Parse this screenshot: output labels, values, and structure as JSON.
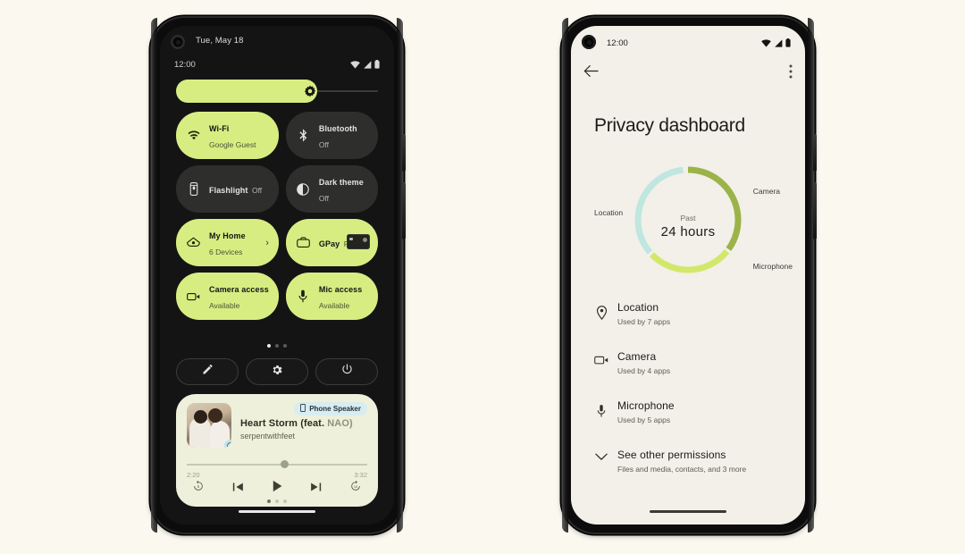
{
  "background_color": "#fbf8f0",
  "accent_green": "#d7ed82",
  "left_phone": {
    "name": "quick-settings-panel",
    "status_bar": {
      "date": "Tue, May 18",
      "clock": "12:00",
      "icons": [
        "wifi-icon",
        "signal-icon",
        "battery-icon"
      ]
    },
    "brightness": {
      "label": "brightness-slider",
      "icon": "brightness-icon",
      "value_percent": 70
    },
    "tiles": [
      {
        "label": "Wi-Fi",
        "sub": "Google Guest",
        "icon": "wifi-icon",
        "state": "on"
      },
      {
        "label": "Bluetooth",
        "sub": "Off",
        "icon": "bluetooth-icon",
        "state": "off"
      },
      {
        "label": "Flashlight",
        "sub": "Off",
        "icon": "flashlight-icon",
        "state": "off"
      },
      {
        "label": "Dark theme",
        "sub": "Off",
        "icon": "contrast-icon",
        "state": "off"
      },
      {
        "label": "My Home",
        "sub": "6 Devices",
        "icon": "home-icon",
        "state": "on",
        "chevron": "›"
      },
      {
        "label": "GPay",
        "sub": "Ready",
        "icon": "wallet-icon",
        "state": "on",
        "card": true
      },
      {
        "label": "Camera access",
        "sub": "Available",
        "icon": "camera-icon",
        "state": "on"
      },
      {
        "label": "Mic access",
        "sub": "Available",
        "icon": "mic-icon",
        "state": "on"
      }
    ],
    "page_dots": {
      "count": 3,
      "active_index": 0
    },
    "actions": [
      {
        "name": "edit-tiles-button",
        "icon": "pencil-icon"
      },
      {
        "name": "settings-button",
        "icon": "gear-icon"
      },
      {
        "name": "power-button",
        "icon": "power-icon"
      }
    ],
    "media": {
      "output_chip": {
        "label": "Phone Speaker",
        "icon": "phone-icon"
      },
      "title": "Heart Storm (feat. ",
      "title_feat": "NAO)",
      "artist": "serpentwithfeet",
      "elapsed": "2:20",
      "duration": "3:32",
      "progress_percent": 52,
      "controls": [
        "replay-5-icon",
        "previous-track-icon",
        "play-icon",
        "next-track-icon",
        "forward-15-icon"
      ],
      "art_badge": "play-badge-icon",
      "page_dots": {
        "count": 3,
        "active_index": 0
      }
    }
  },
  "right_phone": {
    "name": "privacy-dashboard-screen",
    "status_bar": {
      "clock": "12:00",
      "icons": [
        "wifi-icon",
        "signal-icon",
        "battery-icon"
      ]
    },
    "app_bar": {
      "back": "back-arrow-icon",
      "overflow": "more-options-icon"
    },
    "page_title": "Privacy dashboard",
    "donut": {
      "center_top": "Past",
      "center_main": "24  hours",
      "labels": {
        "location": "Location",
        "camera": "Camera",
        "microphone": "Microphone"
      },
      "colors": {
        "camera": "#9bb348",
        "microphone": "#d2e86a",
        "location": "#bfe6df"
      }
    },
    "permissions": [
      {
        "name": "Location",
        "sub": "Used by 7 apps",
        "icon": "location-pin-icon"
      },
      {
        "name": "Camera",
        "sub": "Used by 4 apps",
        "icon": "camera-icon"
      },
      {
        "name": "Microphone",
        "sub": "Used by 5 apps",
        "icon": "mic-icon"
      },
      {
        "name": "See other permissions",
        "sub": "Files and media, contacts, and 3 more",
        "icon": "chevron-down-icon"
      }
    ]
  }
}
